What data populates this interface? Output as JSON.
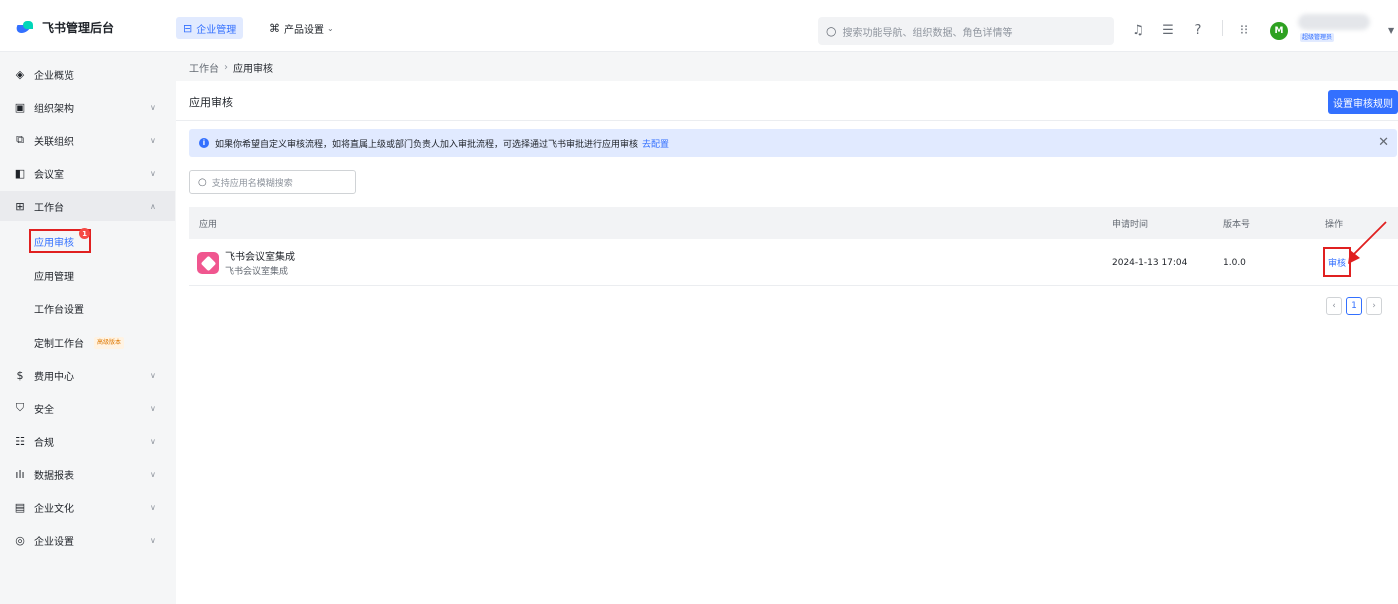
{
  "app": {
    "name": "飞书管理后台"
  },
  "topnav": {
    "tabs": [
      {
        "label": "企业管理",
        "icon": "enterprise-icon"
      },
      {
        "label": "产品设置",
        "icon": "product-settings-icon"
      }
    ],
    "search_placeholder": "搜索功能导航、组织数据、角色详情等",
    "avatar_initial": "M",
    "admin_badge": "超级管理员"
  },
  "sidebar": {
    "items": [
      {
        "label": "企业概览",
        "icon": "layers-icon"
      },
      {
        "label": "组织架构",
        "icon": "org-icon"
      },
      {
        "label": "关联组织",
        "icon": "link-org-icon"
      },
      {
        "label": "会议室",
        "icon": "meeting-room-icon"
      },
      {
        "label": "工作台",
        "icon": "grid-icon"
      },
      {
        "label": "费用中心",
        "icon": "dollar-icon"
      },
      {
        "label": "安全",
        "icon": "shield-icon"
      },
      {
        "label": "合规",
        "icon": "compliance-icon"
      },
      {
        "label": "数据报表",
        "icon": "bar-chart-icon"
      },
      {
        "label": "企业文化",
        "icon": "culture-icon"
      },
      {
        "label": "企业设置",
        "icon": "settings-icon"
      }
    ],
    "workbench_children": [
      {
        "label": "应用审核",
        "badge": "1"
      },
      {
        "label": "应用管理"
      },
      {
        "label": "工作台设置"
      },
      {
        "label": "定制工作台",
        "tag": "高级版本"
      }
    ]
  },
  "breadcrumb": {
    "root": "工作台",
    "current": "应用审核"
  },
  "page": {
    "title": "应用审核",
    "rule_button": "设置审核规则",
    "notice_text": "如果你希望自定义审核流程，如将直属上级或部门负责人加入审批流程，可选择通过飞书审批进行应用审核",
    "notice_link": "去配置",
    "search_placeholder": "支持应用名模糊搜索"
  },
  "table": {
    "headers": [
      "应用",
      "申请时间",
      "版本号",
      "操作"
    ],
    "rows": [
      {
        "app_name": "飞书会议室集成",
        "app_desc": "飞书会议室集成",
        "time": "2024-1-13 17:04",
        "version": "1.0.0",
        "action": "审核"
      }
    ]
  },
  "pagination": {
    "current": "1"
  },
  "colors": {
    "accent": "#3370ff",
    "highlight": "#e02020"
  }
}
